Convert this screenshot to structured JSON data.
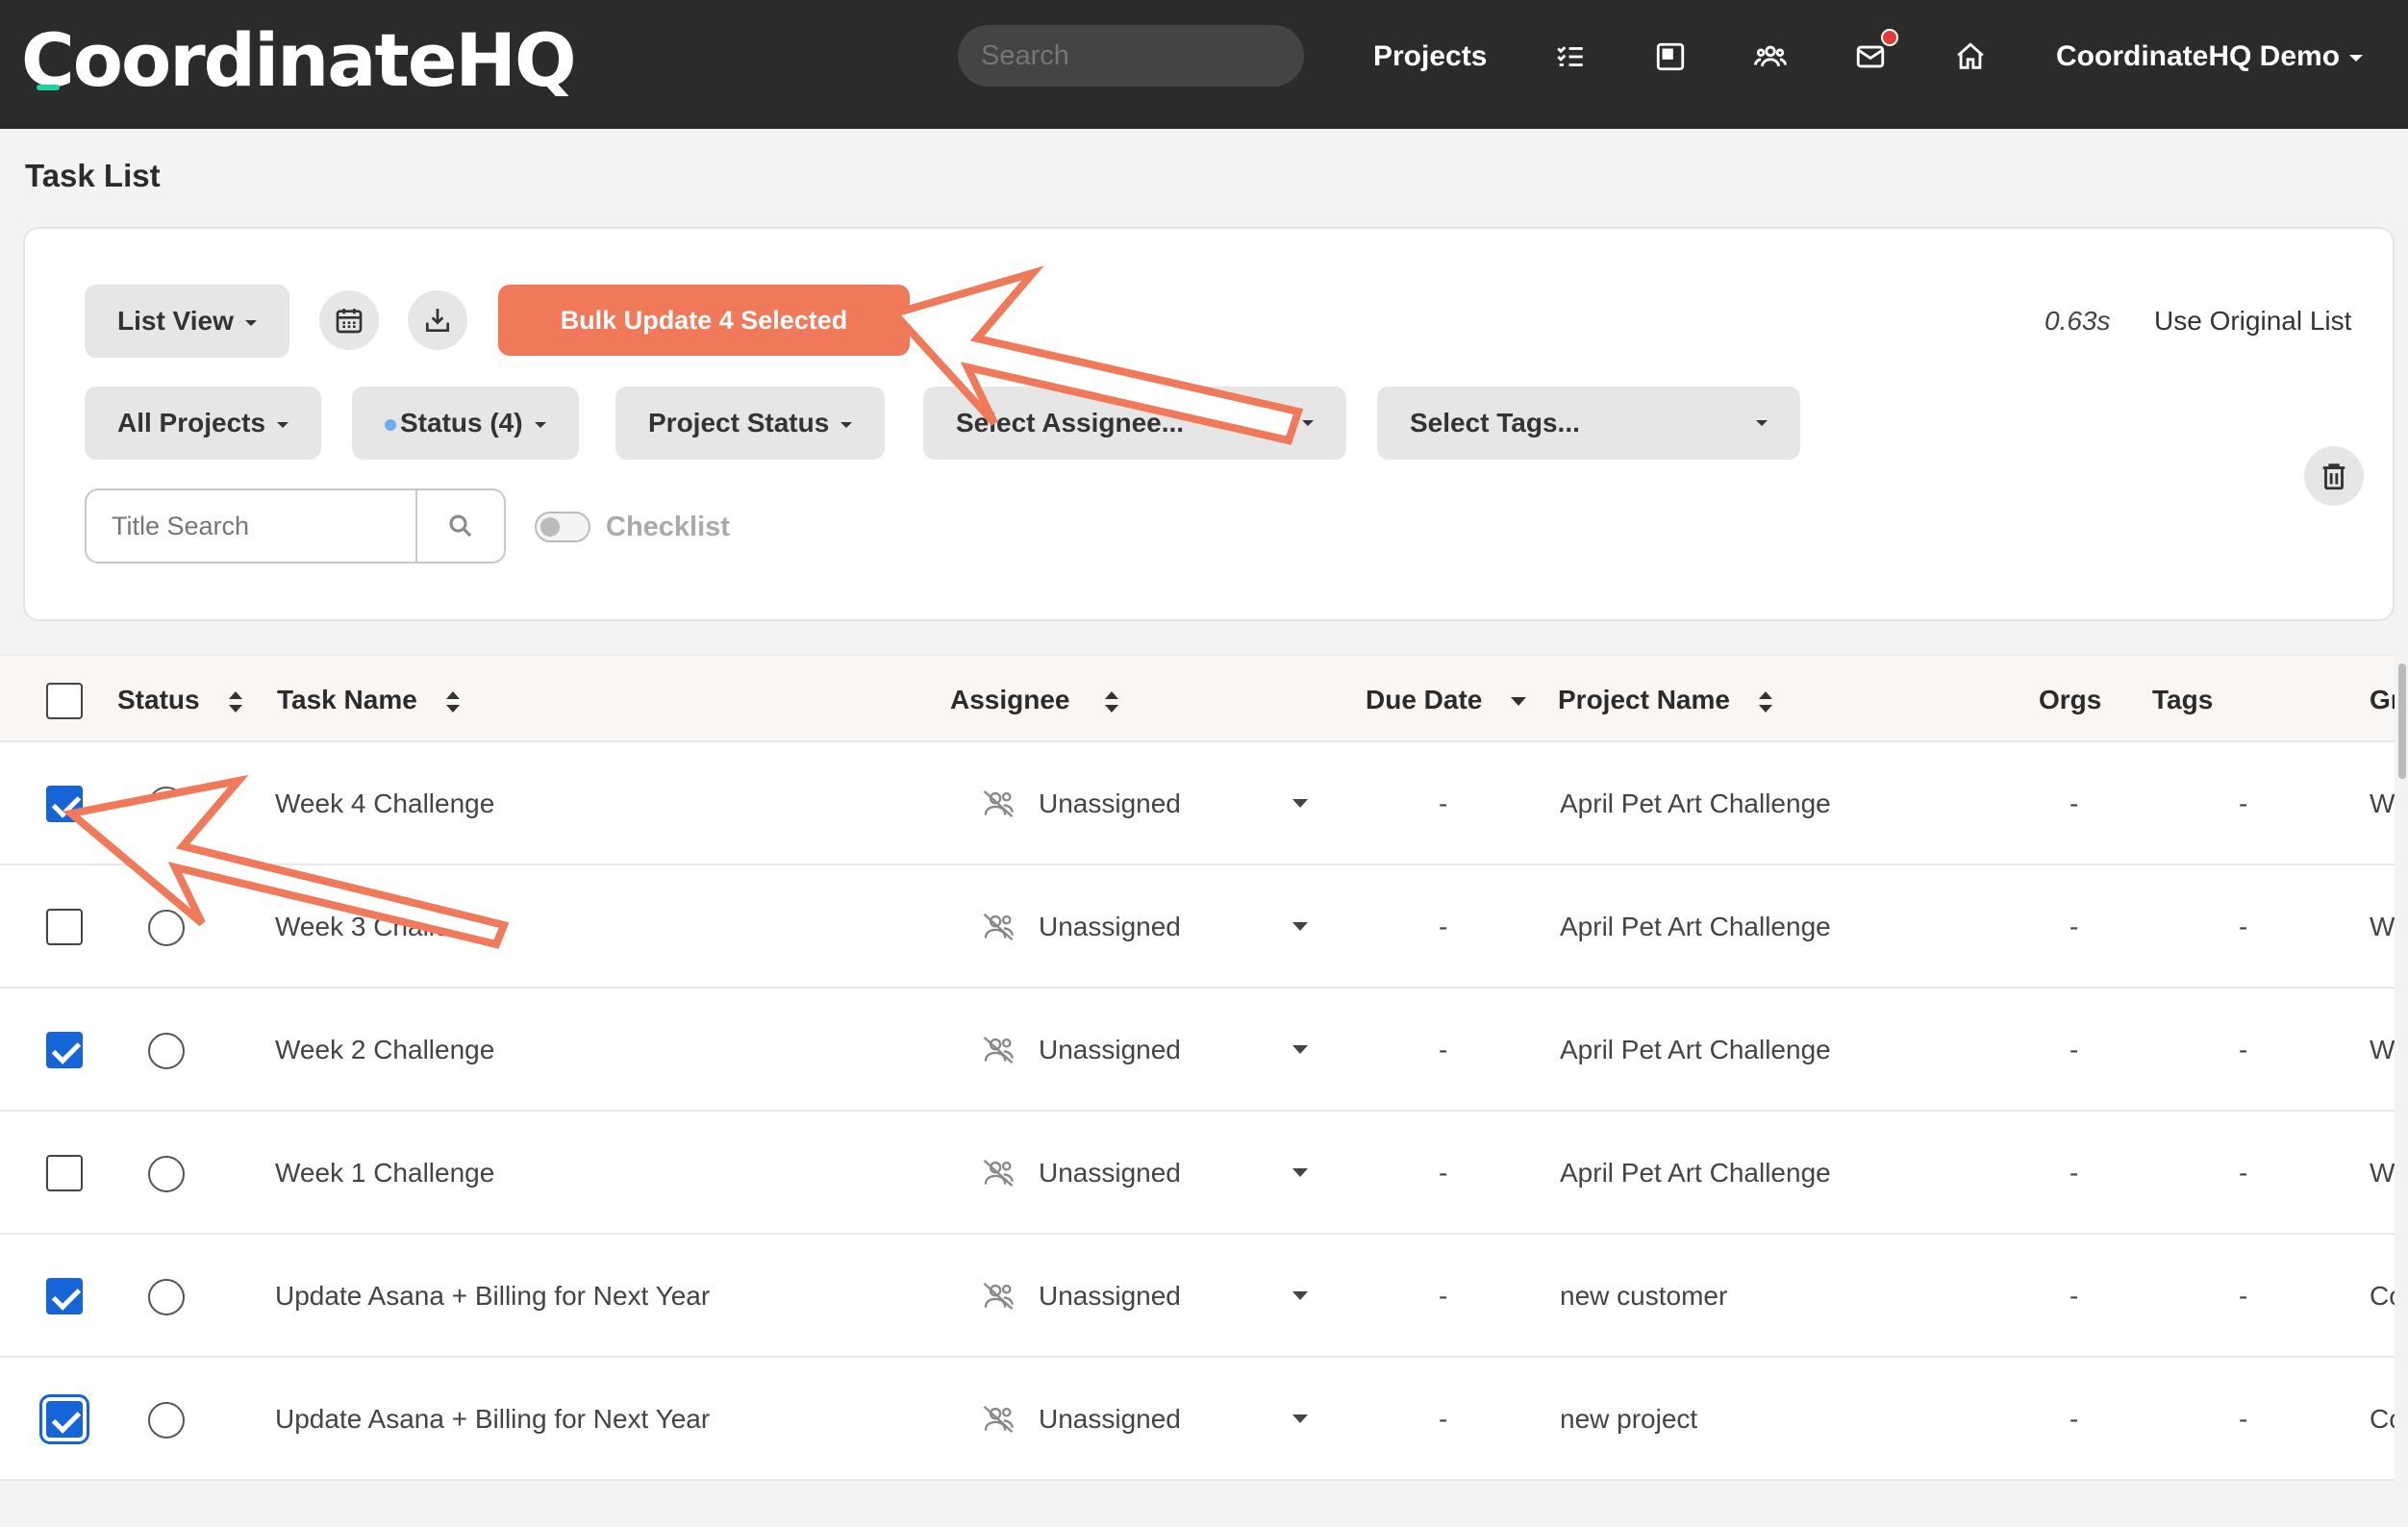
{
  "nav": {
    "logo": "CoordinateHQ",
    "search_placeholder": "Search",
    "projects": "Projects",
    "user": "CoordinateHQ Demo",
    "icons": [
      "tasks-icon",
      "board-icon",
      "people-icon",
      "mail-icon",
      "home-icon"
    ]
  },
  "page": {
    "title": "Task List"
  },
  "toolbar": {
    "list_view": "List View",
    "bulk_update": "Bulk Update 4 Selected",
    "timing": "0.63s",
    "use_original": "Use Original List"
  },
  "filters": {
    "all_projects": "All Projects",
    "status": "Status (4)",
    "project_status": "Project Status",
    "assignee": "Select Assignee...",
    "tags": "Select Tags...",
    "title_search_placeholder": "Title Search",
    "checklist": "Checklist"
  },
  "table": {
    "headers": {
      "status": "Status",
      "task_name": "Task Name",
      "assignee": "Assignee",
      "due_date": "Due Date",
      "project_name": "Project Name",
      "orgs": "Orgs",
      "tags": "Tags",
      "group": "Gr"
    },
    "rows": [
      {
        "checked": true,
        "focused": false,
        "task": "Week 4 Challenge",
        "assignee": "Unassigned",
        "due": "-",
        "project": "April Pet Art Challenge",
        "orgs": "-",
        "tags": "-",
        "group": "W"
      },
      {
        "checked": false,
        "focused": false,
        "task": "Week 3 Challe",
        "assignee": "Unassigned",
        "due": "-",
        "project": "April Pet Art Challenge",
        "orgs": "-",
        "tags": "-",
        "group": "W"
      },
      {
        "checked": true,
        "focused": false,
        "task": "Week 2 Challenge",
        "assignee": "Unassigned",
        "due": "-",
        "project": "April Pet Art Challenge",
        "orgs": "-",
        "tags": "-",
        "group": "W"
      },
      {
        "checked": false,
        "focused": false,
        "task": "Week 1 Challenge",
        "assignee": "Unassigned",
        "due": "-",
        "project": "April Pet Art Challenge",
        "orgs": "-",
        "tags": "-",
        "group": "W"
      },
      {
        "checked": true,
        "focused": false,
        "task": "Update Asana + Billing for Next Year",
        "assignee": "Unassigned",
        "due": "-",
        "project": "new customer",
        "orgs": "-",
        "tags": "-",
        "group": "Co"
      },
      {
        "checked": true,
        "focused": true,
        "task": "Update Asana + Billing for Next Year",
        "assignee": "Unassigned",
        "due": "-",
        "project": "new project",
        "orgs": "-",
        "tags": "-",
        "group": "Co"
      }
    ]
  },
  "colors": {
    "nav_bg": "#2b2b2b",
    "accent": "#f0795a",
    "checkbox": "#1565d8",
    "logo_accent": "#1fd1a0",
    "annotation": "#f0795a"
  }
}
